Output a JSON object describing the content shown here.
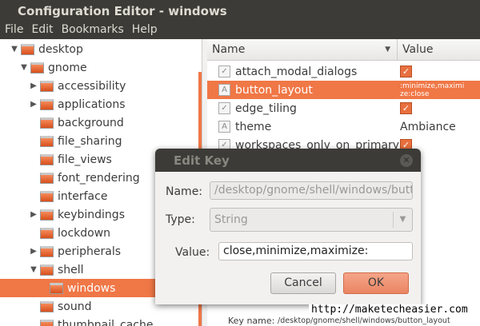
{
  "window": {
    "title": "Configuration Editor - windows"
  },
  "menu": [
    "File",
    "Edit",
    "Bookmarks",
    "Help"
  ],
  "tree": [
    {
      "label": "desktop",
      "level": 0,
      "arrow": "down"
    },
    {
      "label": "gnome",
      "level": 1,
      "arrow": "down"
    },
    {
      "label": "accessibility",
      "level": 2,
      "arrow": "right"
    },
    {
      "label": "applications",
      "level": 2,
      "arrow": "right"
    },
    {
      "label": "background",
      "level": 2,
      "arrow": ""
    },
    {
      "label": "file_sharing",
      "level": 2,
      "arrow": ""
    },
    {
      "label": "file_views",
      "level": 2,
      "arrow": ""
    },
    {
      "label": "font_rendering",
      "level": 2,
      "arrow": ""
    },
    {
      "label": "interface",
      "level": 2,
      "arrow": ""
    },
    {
      "label": "keybindings",
      "level": 2,
      "arrow": "right"
    },
    {
      "label": "lockdown",
      "level": 2,
      "arrow": ""
    },
    {
      "label": "peripherals",
      "level": 2,
      "arrow": "right"
    },
    {
      "label": "shell",
      "level": 2,
      "arrow": "down"
    },
    {
      "label": "windows",
      "level": 3,
      "arrow": "",
      "selected": true
    },
    {
      "label": "sound",
      "level": 2,
      "arrow": ""
    },
    {
      "label": "thumbnail_cache",
      "level": 2,
      "arrow": ""
    }
  ],
  "keys": {
    "headers": {
      "name": "Name",
      "value": "Value"
    },
    "rows": [
      {
        "name": "attach_modal_dialogs",
        "type": "bool",
        "value": "✓"
      },
      {
        "name": "button_layout",
        "type": "string",
        "value": ":minimize,maximize:close",
        "selected": true
      },
      {
        "name": "edge_tiling",
        "type": "bool",
        "value": "✓"
      },
      {
        "name": "theme",
        "type": "string",
        "value": "Ambiance"
      },
      {
        "name": "workspaces_only_on_primary",
        "type": "bool",
        "value": "✓"
      }
    ]
  },
  "dialog": {
    "title": "Edit Key",
    "name_label": "Name:",
    "name_value": "/desktop/gnome/shell/windows/button_layout",
    "type_label": "Type:",
    "type_value": "String",
    "value_label": "Value:",
    "value_value": "close,minimize,maximize:",
    "cancel": "Cancel",
    "ok": "OK"
  },
  "details": {
    "key_name_label": "Key name:",
    "key_name_value": "/desktop/gnome/shell/windows/button_layout"
  },
  "watermark": "http://maketecheasier.com",
  "colors": {
    "accent": "#f07746",
    "titlebar": "#3c3b37"
  }
}
